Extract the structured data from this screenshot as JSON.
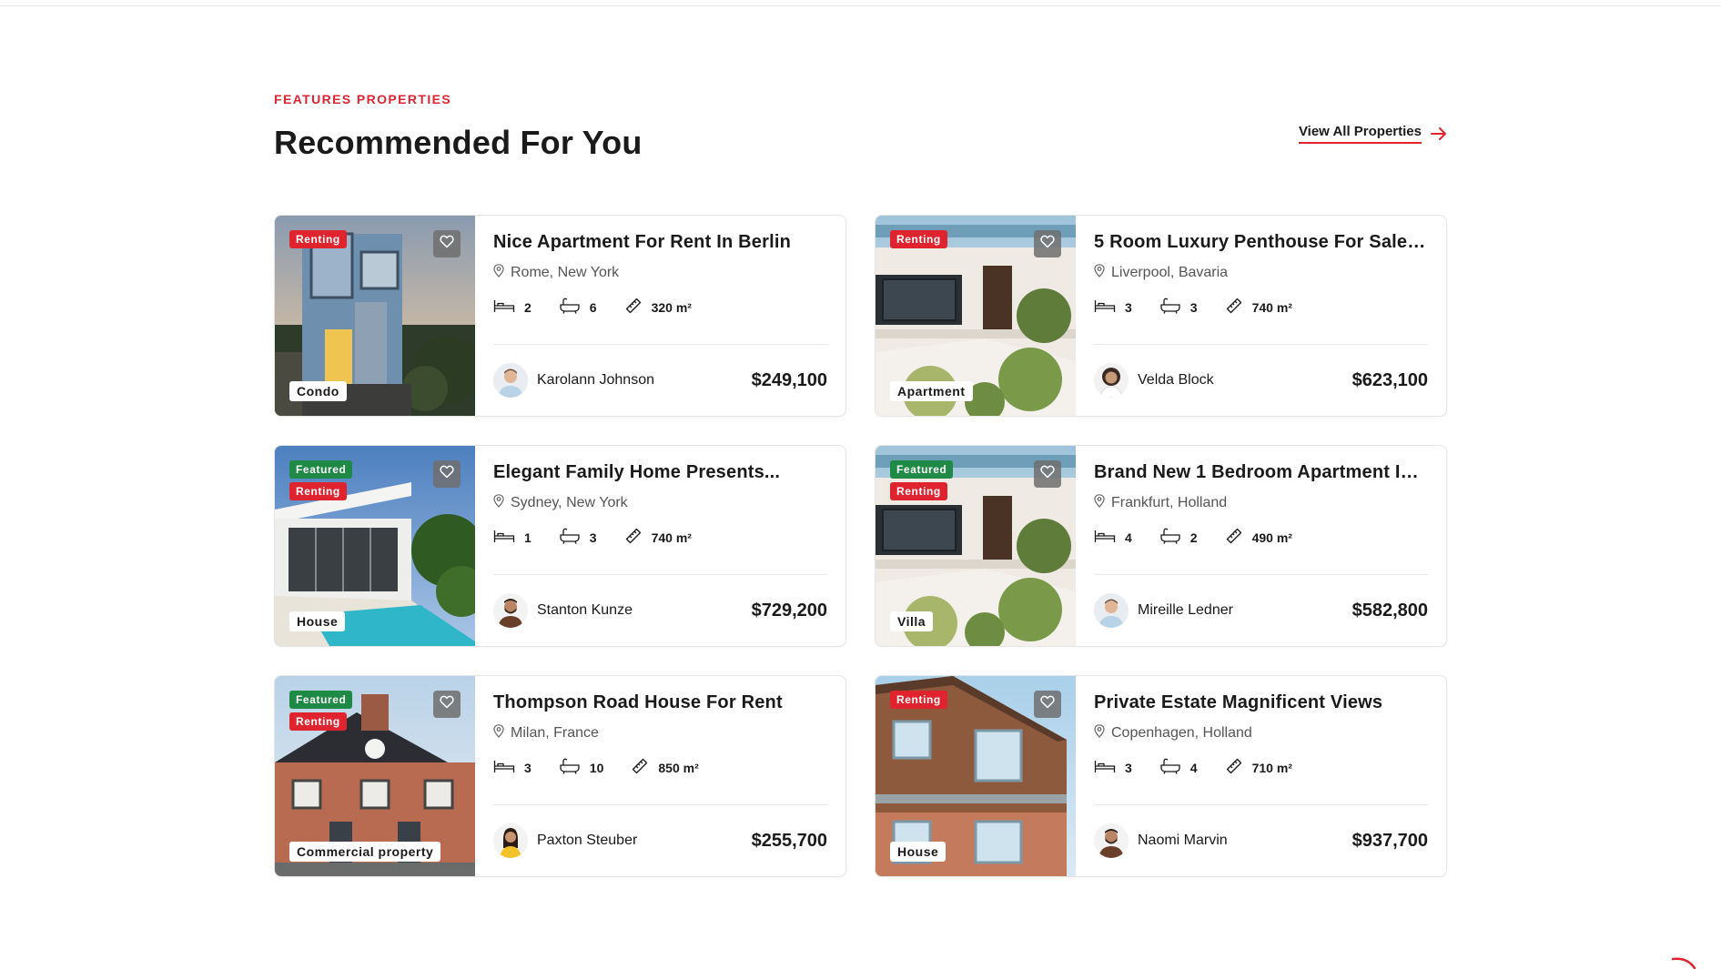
{
  "section": {
    "eyebrow": "FEATURES PROPERTIES",
    "heading": "Recommended For You",
    "view_all": "View All Properties"
  },
  "colors": {
    "accent": "#e0242f",
    "featured": "#1e8a45"
  },
  "listings": [
    {
      "title": "Nice Apartment For Rent In Berlin",
      "location": "Rome, New York",
      "beds": "2",
      "baths": "6",
      "area": "320 m²",
      "agent": "Karolann Johnson",
      "price": "$249,100",
      "badges": [
        "Renting"
      ],
      "type": "Condo",
      "scene": "modern-condo",
      "avatar": "man-light-shirt"
    },
    {
      "title": "5 Room Luxury Penthouse For Sale In...",
      "location": "Liverpool, Bavaria",
      "beds": "3",
      "baths": "3",
      "area": "740 m²",
      "agent": "Velda Block",
      "price": "$623,100",
      "badges": [
        "Renting"
      ],
      "type": "Apartment",
      "scene": "white-villa-garden",
      "avatar": "woman-curly"
    },
    {
      "title": "Elegant Family Home Presents...",
      "location": "Sydney, New York",
      "beds": "1",
      "baths": "3",
      "area": "740 m²",
      "agent": "Stanton Kunze",
      "price": "$729,200",
      "badges": [
        "Featured",
        "Renting"
      ],
      "type": "House",
      "scene": "pool-house",
      "avatar": "man-beard-dark"
    },
    {
      "title": "Brand New 1 Bedroom Apartment In...",
      "location": "Frankfurt, Holland",
      "beds": "4",
      "baths": "2",
      "area": "490 m²",
      "agent": "Mireille Ledner",
      "price": "$582,800",
      "badges": [
        "Featured",
        "Renting"
      ],
      "type": "Villa",
      "scene": "white-villa-garden",
      "avatar": "man-light-shirt"
    },
    {
      "title": "Thompson Road House For Rent",
      "location": "Milan, France",
      "beds": "3",
      "baths": "10",
      "area": "850 m²",
      "agent": "Paxton Steuber",
      "price": "$255,700",
      "badges": [
        "Featured",
        "Renting"
      ],
      "type": "Commercial property",
      "scene": "brick-house",
      "avatar": "woman-yellow"
    },
    {
      "title": "Private Estate Magnificent Views",
      "location": "Copenhagen, Holland",
      "beds": "3",
      "baths": "4",
      "area": "710 m²",
      "agent": "Naomi Marvin",
      "price": "$937,700",
      "badges": [
        "Renting"
      ],
      "type": "House",
      "scene": "wood-apartment",
      "avatar": "man-beard-dark"
    }
  ]
}
